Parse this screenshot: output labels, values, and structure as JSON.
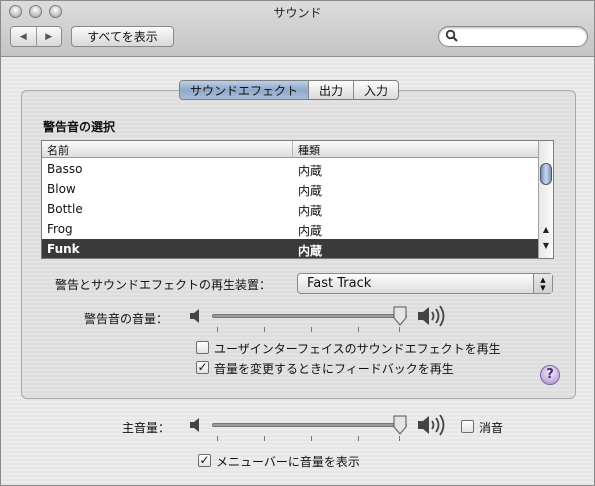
{
  "window": {
    "title": "サウンド"
  },
  "toolbar": {
    "back_icon": "back-arrow-icon",
    "forward_icon": "forward-arrow-icon",
    "show_all_label": "すべてを表示",
    "search_placeholder": ""
  },
  "tabs": [
    {
      "label": "サウンドエフェクト",
      "selected": true
    },
    {
      "label": "出力",
      "selected": false
    },
    {
      "label": "入力",
      "selected": false
    }
  ],
  "effects": {
    "section_title": "警告音の選択",
    "columns": [
      "名前",
      "種類"
    ],
    "rows": [
      {
        "name": "Basso",
        "type": "内蔵"
      },
      {
        "name": "Blow",
        "type": "内蔵"
      },
      {
        "name": "Bottle",
        "type": "内蔵"
      },
      {
        "name": "Frog",
        "type": "内蔵"
      },
      {
        "name": "Funk",
        "type": "内蔵",
        "selected": true
      }
    ],
    "output_device_label": "警告とサウンドエフェクトの再生装置：",
    "output_device_value": "Fast Track",
    "alert_volume_label": "警告音の音量：",
    "alert_volume_level": 0.9,
    "ui_sound_label": "ユーザインターフェイスのサウンドエフェクトを再生",
    "ui_sound_checked": false,
    "feedback_label": "音量を変更するときにフィードバックを再生",
    "feedback_checked": true,
    "help_label": "?"
  },
  "main": {
    "volume_label": "主音量：",
    "volume_level": 0.9,
    "mute_label": "消音",
    "mute_checked": false,
    "show_in_menubar_label": "メニューバーに音量を表示",
    "show_in_menubar_checked": true
  }
}
